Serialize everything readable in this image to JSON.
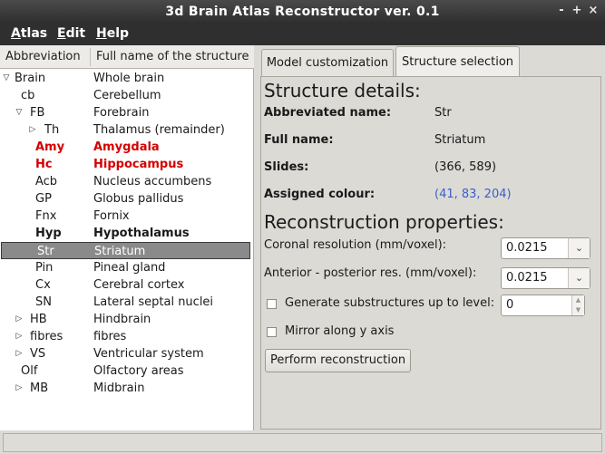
{
  "window": {
    "title": "3d Brain Atlas Reconstructor ver. 0.1",
    "controls": [
      "-",
      "+",
      "×"
    ]
  },
  "menubar": {
    "items": [
      {
        "label": "Atlas",
        "mnemonic": "A",
        "rest": "tlas"
      },
      {
        "label": "Edit",
        "mnemonic": "E",
        "rest": "dit"
      },
      {
        "label": "Help",
        "mnemonic": "H",
        "rest": "elp"
      }
    ]
  },
  "tree": {
    "columns": [
      "Abbreviation",
      "Full name of the structure"
    ],
    "rows": [
      {
        "abbr": "Brain",
        "full": "Whole brain",
        "expander": "open",
        "style": ""
      },
      {
        "abbr": "cb",
        "full": "Cerebellum",
        "expander": "",
        "style": ""
      },
      {
        "abbr": "FB",
        "full": "Forebrain",
        "expander": "open",
        "style": ""
      },
      {
        "abbr": "Th",
        "full": "Thalamus (remainder)",
        "expander": "closed",
        "style": ""
      },
      {
        "abbr": "Amy",
        "full": "Amygdala",
        "expander": "",
        "style": "red"
      },
      {
        "abbr": "Hc",
        "full": "Hippocampus",
        "expander": "",
        "style": "red"
      },
      {
        "abbr": "Acb",
        "full": "Nucleus accumbens",
        "expander": "",
        "style": ""
      },
      {
        "abbr": "GP",
        "full": "Globus pallidus",
        "expander": "",
        "style": ""
      },
      {
        "abbr": "Fnx",
        "full": "Fornix",
        "expander": "",
        "style": ""
      },
      {
        "abbr": "Hyp",
        "full": "Hypothalamus",
        "expander": "",
        "style": "bold"
      },
      {
        "abbr": "Str",
        "full": "Striatum",
        "expander": "",
        "style": "selected"
      },
      {
        "abbr": "Pin",
        "full": "Pineal gland",
        "expander": "",
        "style": ""
      },
      {
        "abbr": "Cx",
        "full": "Cerebral cortex",
        "expander": "",
        "style": ""
      },
      {
        "abbr": "SN",
        "full": "Lateral septal nuclei",
        "expander": "",
        "style": ""
      },
      {
        "abbr": "HB",
        "full": "Hindbrain",
        "expander": "closed",
        "style": ""
      },
      {
        "abbr": "fibres",
        "full": "fibres",
        "expander": "closed",
        "style": ""
      },
      {
        "abbr": "VS",
        "full": "Ventricular system",
        "expander": "closed",
        "style": ""
      },
      {
        "abbr": "Olf",
        "full": "Olfactory areas",
        "expander": "",
        "style": ""
      },
      {
        "abbr": "MB",
        "full": "Midbrain",
        "expander": "closed",
        "style": ""
      }
    ]
  },
  "tabs": [
    {
      "label": "Model customization",
      "active": false
    },
    {
      "label": "Structure selection",
      "active": true
    }
  ],
  "details": {
    "heading": "Structure details:",
    "abbr_label": "Abbreviated name:",
    "abbr_value": "Str",
    "full_label": "Full name:",
    "full_value": "Striatum",
    "slides_label": "Slides:",
    "slides_value": "(366, 589)",
    "colour_label": "Assigned colour:",
    "colour_value": "(41, 83, 204)"
  },
  "reconstruction": {
    "heading": "Reconstruction properties:",
    "coronal_label": "Coronal resolution (mm/voxel):",
    "coronal_value": "0.0215",
    "ap_label": "Anterior - posterior res. (mm/voxel):",
    "ap_value": "0.0215",
    "substructures_label": "Generate substructures up to level:",
    "substructures_value": "0",
    "substructures_checked": false,
    "mirror_label": "Mirror along y axis",
    "mirror_checked": false,
    "perform_button": "Perform reconstruction"
  },
  "statusbar": {
    "text": ""
  },
  "colors": {
    "highlight_red": "#d40000",
    "colour_value_blue": "#3a5fcd",
    "selection_bg": "#8a8a8a"
  }
}
